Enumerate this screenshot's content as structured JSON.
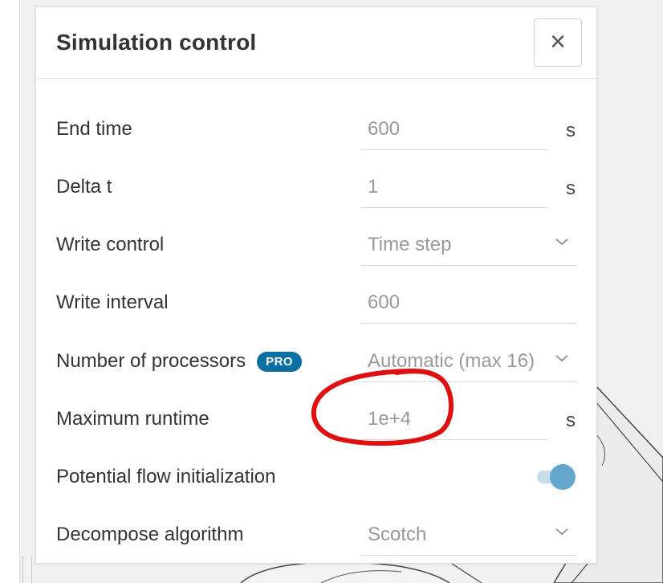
{
  "panel": {
    "title": "Simulation control",
    "close_icon": "×"
  },
  "rows": [
    {
      "label": "End time",
      "value": "600",
      "unit": "s",
      "type": "input"
    },
    {
      "label": "Delta t",
      "value": "1",
      "unit": "s",
      "type": "input"
    },
    {
      "label": "Write control",
      "value": "Time step",
      "type": "select"
    },
    {
      "label": "Write interval",
      "value": "600",
      "type": "input"
    },
    {
      "label": "Number of processors",
      "badge": "PRO",
      "value": "Automatic (max 16)",
      "type": "select"
    },
    {
      "label": "Maximum runtime",
      "value": "1e+4",
      "unit": "s",
      "type": "input"
    },
    {
      "label": "Potential flow initialization",
      "type": "toggle",
      "enabled": true
    },
    {
      "label": "Decompose algorithm",
      "value": "Scotch",
      "type": "select"
    }
  ],
  "colors": {
    "badge": "#0a6fa3",
    "toggle_knob": "#63a7cc",
    "annotation": "#e01010"
  },
  "icons": {
    "close": "close-icon",
    "dropdown": "chevron-down-icon"
  }
}
